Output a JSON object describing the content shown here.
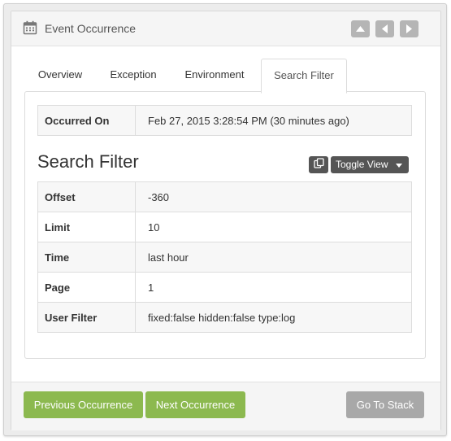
{
  "panel": {
    "title": "Event Occurrence",
    "header_icon": "calendar-icon",
    "nav_buttons": [
      "collapse-up-icon",
      "previous-icon",
      "next-icon"
    ]
  },
  "tabs": [
    {
      "label": "Overview",
      "active": false
    },
    {
      "label": "Exception",
      "active": false
    },
    {
      "label": "Environment",
      "active": false
    },
    {
      "label": "Search Filter",
      "active": true
    }
  ],
  "occurred": {
    "label": "Occurred On",
    "value": "Feb 27, 2015 3:28:54 PM (30 minutes ago)"
  },
  "search_filter": {
    "title": "Search Filter",
    "toggle_label": "Toggle View",
    "rows": [
      {
        "key": "Offset",
        "value": "-360"
      },
      {
        "key": "Limit",
        "value": "10"
      },
      {
        "key": "Time",
        "value": "last hour"
      },
      {
        "key": "Page",
        "value": "1"
      },
      {
        "key": "User Filter",
        "value": "fixed:false hidden:false type:log"
      }
    ]
  },
  "footer": {
    "previous_label": "Previous Occurrence",
    "next_label": "Next Occurrence",
    "stack_label": "Go To Stack"
  },
  "colors": {
    "green_button": "#8cb94f",
    "grey_button": "#a8a8a8",
    "dark_button": "#555555"
  }
}
